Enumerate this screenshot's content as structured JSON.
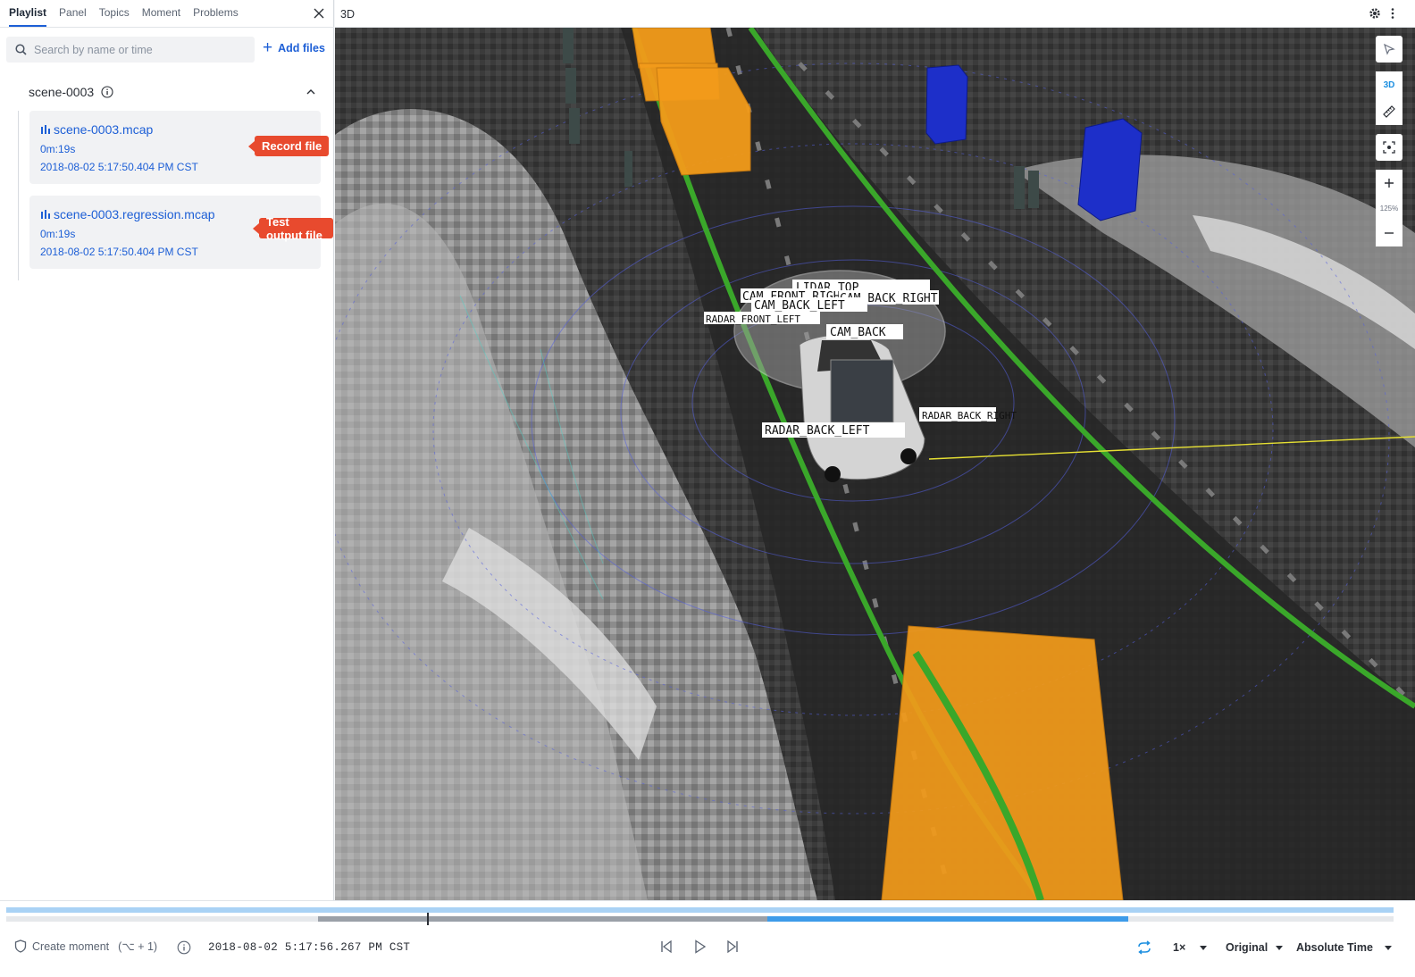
{
  "sidebar": {
    "tabs": [
      {
        "label": "Playlist",
        "active": true
      },
      {
        "label": "Panel",
        "active": false
      },
      {
        "label": "Topics",
        "active": false
      },
      {
        "label": "Moment",
        "active": false
      },
      {
        "label": "Problems",
        "active": false
      }
    ],
    "search": {
      "placeholder": "Search by name or time",
      "value": ""
    },
    "add_files_label": "Add files",
    "scene": {
      "title": "scene-0003",
      "files": [
        {
          "name": "scene-0003.mcap",
          "duration": "0m:19s",
          "date": "2018-08-02 5:17:50.404 PM CST",
          "callout": "Record file"
        },
        {
          "name": "scene-0003.regression.mcap",
          "duration": "0m:19s",
          "date": "2018-08-02 5:17:50.404 PM CST",
          "callout": "Test output file"
        }
      ]
    }
  },
  "panel": {
    "title": "3D",
    "tools": {
      "mode_label": "3D",
      "zoom_label": "125%"
    },
    "scene_labels": [
      "LIDAR_TOP",
      "CAM_FRONT_RIGHT",
      "CAM_FRONT",
      "CAM_BACK_RIGHT",
      "CAM_BACK_LEFT",
      "RADAR_FRONT_LEFT",
      "CAM_BACK",
      "RADAR_BACK_RIGHT",
      "RADAR_BACK_LEFT"
    ],
    "colors": {
      "lane": "#3aa72a",
      "box_orange": "#f39b1a",
      "box_blue": "#1d2fc9",
      "ground": "#2a2a2a"
    }
  },
  "playback": {
    "create_moment_label": "Create moment",
    "create_moment_shortcut": "(⌥ + 1)",
    "current_time": "2018-08-02 5:17:56.267 PM CST",
    "speed": "1×",
    "mode": "Original",
    "time_format": "Absolute Time",
    "progress": 0.3
  }
}
